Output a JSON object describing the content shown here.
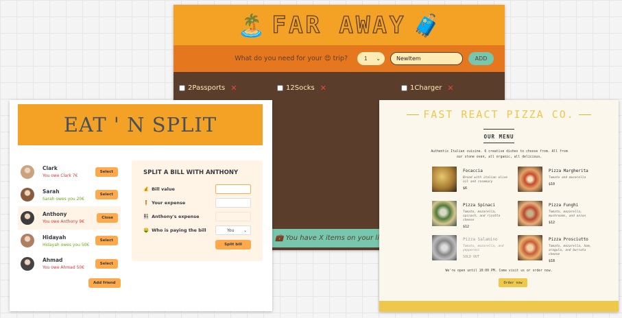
{
  "far_away": {
    "title": "FAR AWAY",
    "emoji_left": "🏝️",
    "emoji_right": "🧳",
    "form": {
      "label": "What do you need for your 😍 trip?",
      "quantity": "1",
      "item_value": "NewItem",
      "add_label": "ADD"
    },
    "items": [
      {
        "label": "2Passports",
        "delete": "✕"
      },
      {
        "label": "12Socks",
        "delete": "✕"
      },
      {
        "label": "1Charger",
        "delete": "✕"
      }
    ],
    "stats": "💼 You have X items on your list, and"
  },
  "eat_n_split": {
    "title": "EAT ' N SPLIT",
    "friends": [
      {
        "name": "Clark",
        "balance": "You owe Clark 7€",
        "status": "red",
        "button": "Select",
        "avatar_color": "#c9a27e"
      },
      {
        "name": "Sarah",
        "balance": "Sarah owes you 20€",
        "status": "green",
        "button": "Select",
        "avatar_color": "#8a5a3c"
      },
      {
        "name": "Anthony",
        "balance": "You owe Anthony 9€",
        "status": "red",
        "button": "Close",
        "avatar_color": "#3d3d3d"
      },
      {
        "name": "Hidayah",
        "balance": "Hidayah owes you 50€",
        "status": "green",
        "button": "Select",
        "avatar_color": "#b07e63"
      },
      {
        "name": "Ahmad",
        "balance": "You owe Ahmad 50€",
        "status": "red",
        "button": "Select",
        "avatar_color": "#444444"
      }
    ],
    "add_friend_label": "Add friend",
    "form": {
      "title": "SPLIT A BILL WITH ANTHONY",
      "bill_value_label": "Bill value",
      "bill_value_icon": "💰",
      "your_expense_label": "Your expense",
      "your_expense_icon": "🧍",
      "friend_expense_label": "Anthony's expense",
      "friend_expense_icon": "👫",
      "payer_label": "Who is paying the bill",
      "payer_icon": "🤑",
      "payer_value": "You",
      "submit_label": "Split bill"
    }
  },
  "pizza": {
    "title": "FAST REACT PIZZA CO.",
    "menu_title": "OUR MENU",
    "intro": "Authentic Italian cuisine. 6 creative dishes to choose from. All from our stone oven, all organic, all delicious.",
    "items": [
      {
        "name": "Focaccia",
        "ingredients": "Bread with italian olive oil and rosemary",
        "price": "$6",
        "image": "focaccia"
      },
      {
        "name": "Pizza Margherita",
        "ingredients": "Tomato and mozarella",
        "price": "$10",
        "image": "margherita"
      },
      {
        "name": "Pizza Spinaci",
        "ingredients": "Tomato, mozarella, spinach, and ricotta cheese",
        "price": "$12",
        "image": "spinaci"
      },
      {
        "name": "Pizza Funghi",
        "ingredients": "Tomato, mozarella, mushrooms, and onion",
        "price": "$12",
        "image": "funghi"
      },
      {
        "name": "Pizza Salamino",
        "ingredients": "Tomato, mozarella, and pepperoni",
        "price": "SOLD OUT",
        "image": "salamino",
        "sold_out": true
      },
      {
        "name": "Pizza Prosciutto",
        "ingredients": "Tomato, mozarella, ham, aragula, and burrata cheese",
        "price": "$18",
        "image": "prosciutto"
      }
    ],
    "footer_text": "We're open until 10:00 PM. Come visit us or order now.",
    "order_label": "Order now"
  }
}
